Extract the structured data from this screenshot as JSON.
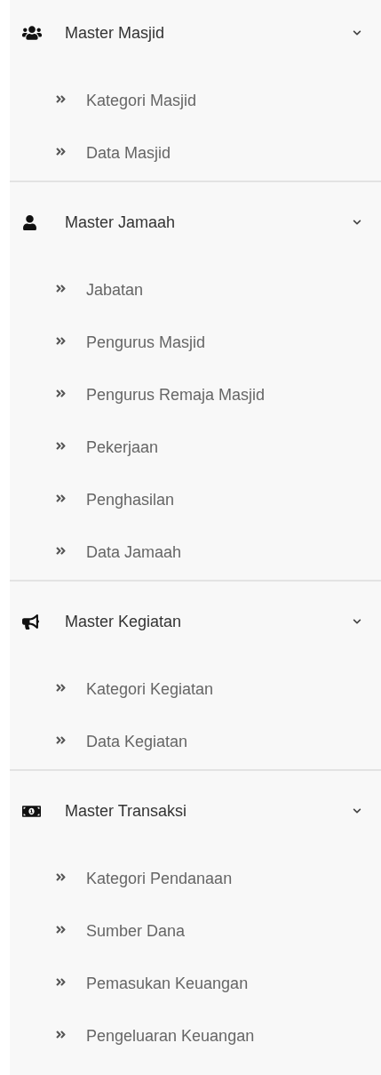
{
  "sections": [
    {
      "title": "Master Masjid",
      "expanded": true,
      "items": [
        "Kategori Masjid",
        "Data Masjid"
      ]
    },
    {
      "title": "Master Jamaah",
      "expanded": true,
      "items": [
        "Jabatan",
        "Pengurus Masjid",
        "Pengurus Remaja Masjid",
        "Pekerjaan",
        "Penghasilan",
        "Data Jamaah"
      ]
    },
    {
      "title": "Master Kegiatan",
      "expanded": true,
      "items": [
        "Kategori Kegiatan",
        "Data Kegiatan"
      ]
    },
    {
      "title": "Master Transaksi",
      "expanded": true,
      "items": [
        "Kategori Pendanaan",
        "Sumber Dana",
        "Pemasukan Keuangan",
        "Pengeluaran Keuangan"
      ]
    }
  ]
}
